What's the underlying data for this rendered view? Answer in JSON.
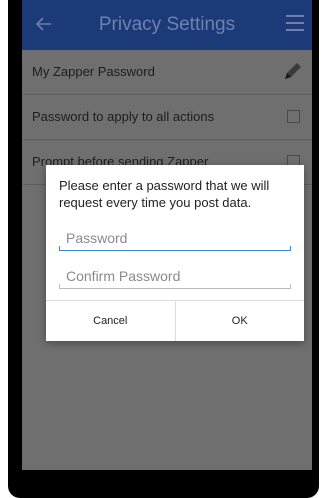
{
  "appbar": {
    "title": "Privacy Settings",
    "back_icon": "arrow-left-icon",
    "menu_icon": "hamburger-menu-icon",
    "color": "#1c3a77"
  },
  "settings": {
    "rows": [
      {
        "label": "My Zapper Password",
        "control": "pencil-icon"
      },
      {
        "label": "Password to apply to all actions",
        "control": "checkbox"
      },
      {
        "label": "Prompt before sending Zapper",
        "control": "checkbox"
      }
    ]
  },
  "dialog": {
    "message": "Please enter a password that we will request every time you post data.",
    "password_placeholder": "Password",
    "confirm_placeholder": "Confirm Password",
    "password_value": "",
    "confirm_value": "",
    "cancel_label": "Cancel",
    "ok_label": "OK"
  },
  "colors": {
    "focus_underline": "#3d82d6",
    "dim_overlay": "#6f6f6f"
  }
}
